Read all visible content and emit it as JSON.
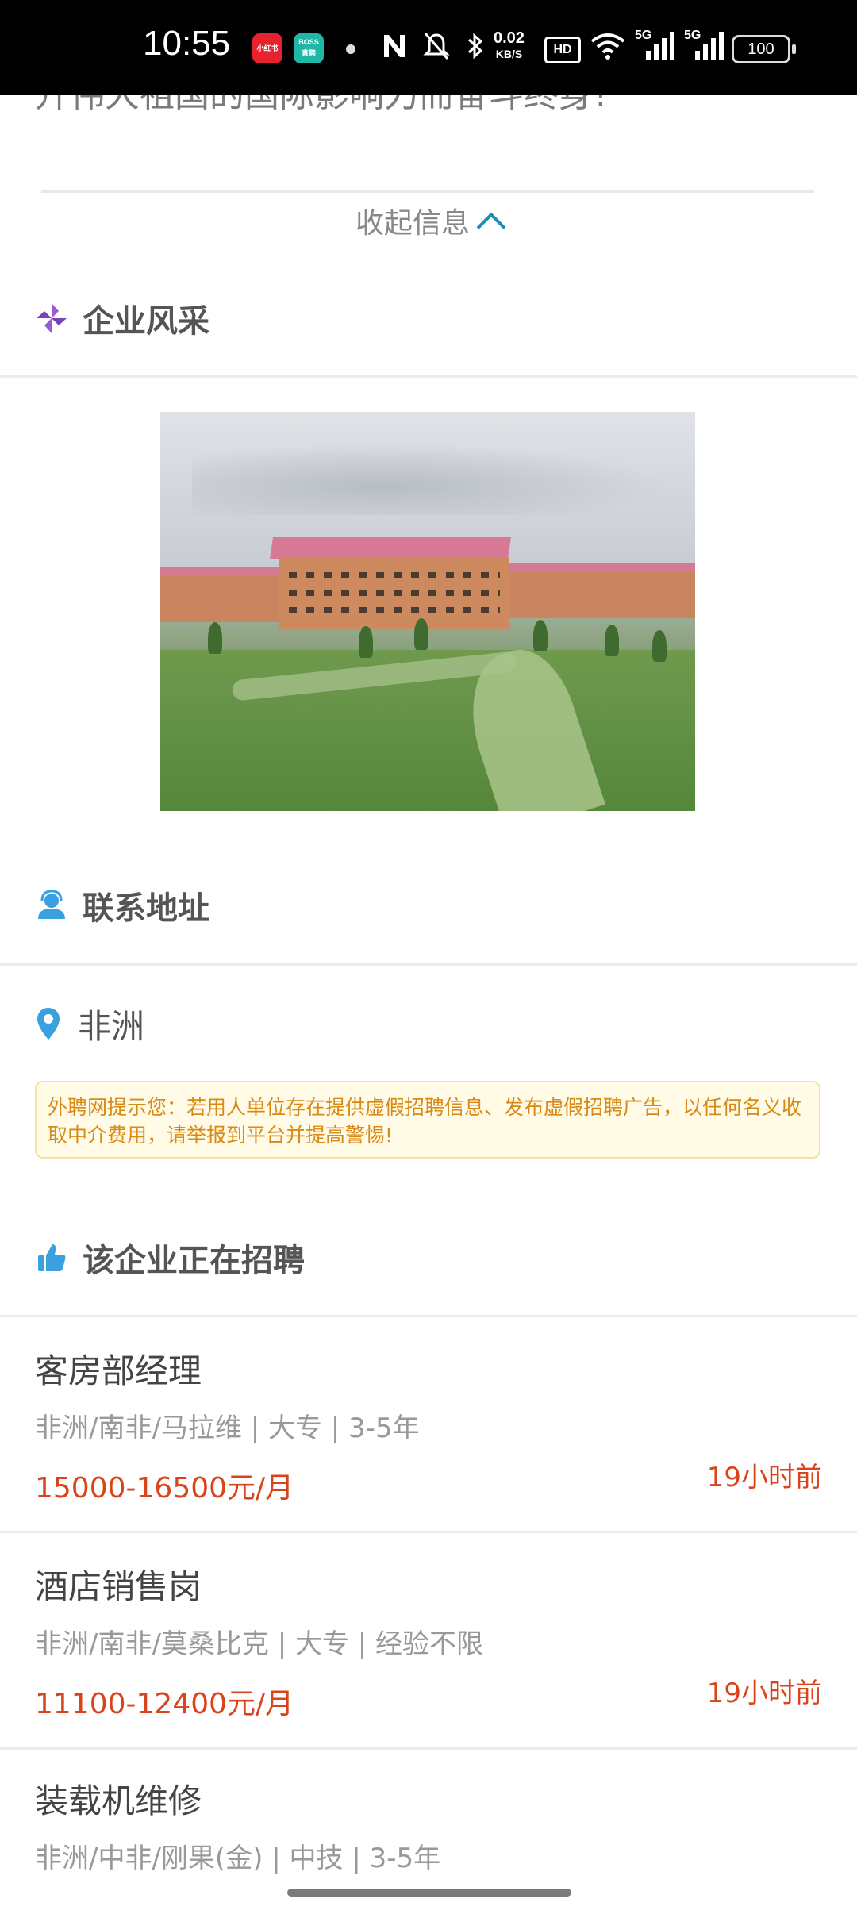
{
  "status_bar": {
    "time": "10:55",
    "app1": "小红书",
    "app2_line1": "BOSS",
    "app2_line2": "直聘",
    "net_speed_value": "0.02",
    "net_speed_unit": "KB/S",
    "hd": "HD",
    "sim1": "5G",
    "sim2": "5G",
    "battery": "100"
  },
  "intro": {
    "tail_text": "升伟大祖国的国际影响力而奋斗终身!",
    "collapse_label": "收起信息"
  },
  "sections": {
    "style_title": "企业风采",
    "contact_title": "联系地址",
    "hiring_title": "该企业正在招聘"
  },
  "address": "非洲",
  "notice": "外聘网提示您：若用人单位存在提供虚假招聘信息、发布虚假招聘广告，以任何名义收取中介费用，请举报到平台并提高警惕!",
  "jobs": [
    {
      "title": "客房部经理",
      "meta": "非洲/南非/马拉维 | 大专 | 3-5年",
      "salary": "15000-16500元/月",
      "time": "19小时前"
    },
    {
      "title": "酒店销售岗",
      "meta": "非洲/南非/莫桑比克 | 大专 | 经验不限",
      "salary": "11100-12400元/月",
      "time": "19小时前"
    },
    {
      "title": "装载机维修",
      "meta": "非洲/中非/刚果(金) | 中技 | 3-5年"
    }
  ],
  "colors": {
    "accent": "#1c8fb0",
    "salary": "#d9441c",
    "notice_text": "#d98a16",
    "notice_bg": "#fffbe6"
  }
}
